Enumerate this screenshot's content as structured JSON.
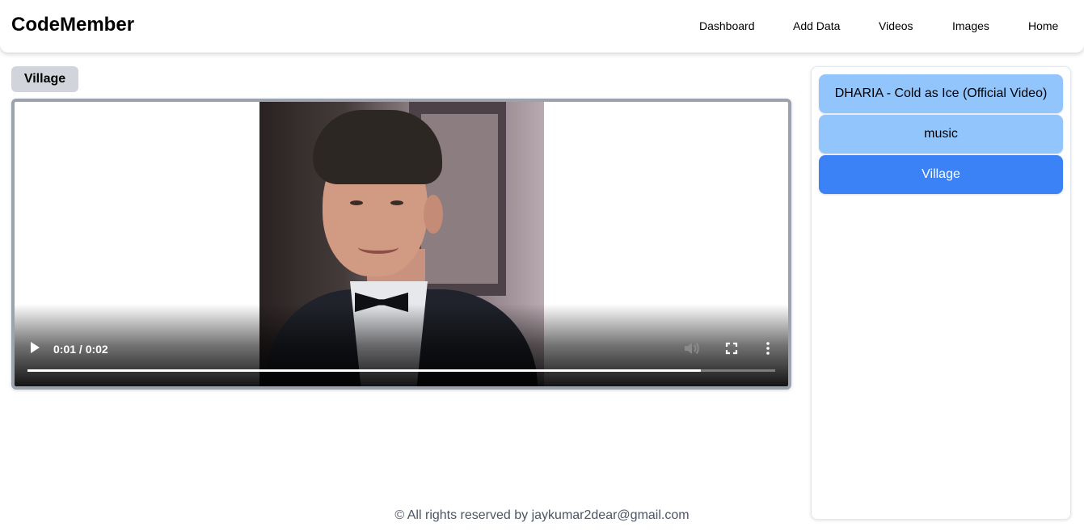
{
  "brand": "CodeMember",
  "nav": {
    "links": [
      "Dashboard",
      "Add Data",
      "Videos",
      "Images",
      "Home"
    ]
  },
  "video": {
    "title": "Village",
    "time_display": "0:01 / 0:02",
    "progress_fraction": 0.9
  },
  "playlist": {
    "items": [
      {
        "label": "DHARIA - Cold as Ice (Official Video)",
        "active": false
      },
      {
        "label": "music",
        "active": false
      },
      {
        "label": "Village",
        "active": true
      }
    ],
    "colors": {
      "item_bg": "#93c5fd",
      "active_bg": "#3b82f6",
      "active_text": "#ffffff"
    }
  },
  "footer": {
    "text": "© All rights reserved by jaykumar2dear@gmail.com"
  }
}
